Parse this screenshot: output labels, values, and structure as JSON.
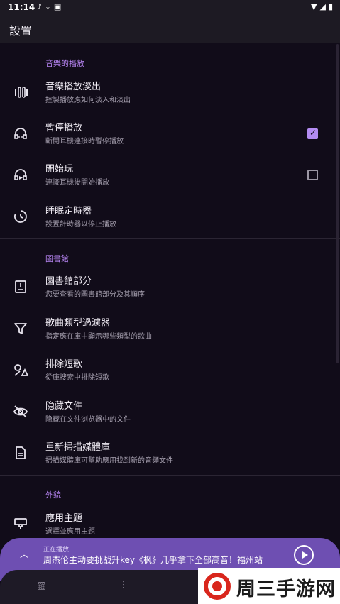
{
  "status_bar": {
    "time": "11:14",
    "left_icons": [
      "music-note-icon",
      "download-icon",
      "a-icon"
    ],
    "right_icons": [
      "wifi-icon",
      "signal-icon",
      "battery-icon"
    ]
  },
  "app_bar": {
    "title": "設置"
  },
  "sections": [
    {
      "header": "音樂的播放",
      "items": [
        {
          "icon": "equalizer-icon",
          "title": "音樂播放淡出",
          "subtitle": "控製播放應如何淡入和淡出"
        },
        {
          "icon": "headphones-icon",
          "title": "暫停播放",
          "subtitle": "斷開耳機連接時暫停播放",
          "checked": true
        },
        {
          "icon": "headphones-play-icon",
          "title": "開始玩",
          "subtitle": "連接耳機後開始播放",
          "checked": false
        },
        {
          "icon": "timer-icon",
          "title": "睡眠定時器",
          "subtitle": "設置計時器以停止播放"
        }
      ]
    },
    {
      "header": "圖書館",
      "items": [
        {
          "icon": "library-book-icon",
          "title": "圖書館部分",
          "subtitle": "您要查看的圖書館部分及其順序"
        },
        {
          "icon": "filter-icon",
          "title": "歌曲類型過濾器",
          "subtitle": "指定應在庫中顯示哪些類型的歌曲"
        },
        {
          "icon": "shapes-icon",
          "title": "排除短歌",
          "subtitle": "從庫搜索中排除短歌"
        },
        {
          "icon": "eye-off-icon",
          "title": "隐藏文件",
          "subtitle": "隐藏在文件浏览器中的文件"
        },
        {
          "icon": "document-icon",
          "title": "重新掃描媒體庫",
          "subtitle": "掃描媒體庫可幫助應用找到新的音頻文件"
        }
      ]
    },
    {
      "header": "外貌",
      "items": [
        {
          "icon": "palette-icon",
          "title": "應用主題",
          "subtitle": "選擇並應用主題"
        }
      ]
    }
  ],
  "player": {
    "label": "正在播放",
    "title": "周杰伦主动要挑战升key《枫》几乎拿下全部高音！福州站",
    "expand_icon": "chevron-up-icon",
    "play_icon": "play-circle-icon"
  },
  "bottom_nav": {
    "icons": [
      "library-icon",
      "equalizer-sliders-icon"
    ]
  },
  "watermark": {
    "text": "周三手游网"
  },
  "colors": {
    "accent": "#b583f0",
    "player_bg": "#6e4fb2",
    "background": "#110c19",
    "bar": "#1d1a23"
  }
}
